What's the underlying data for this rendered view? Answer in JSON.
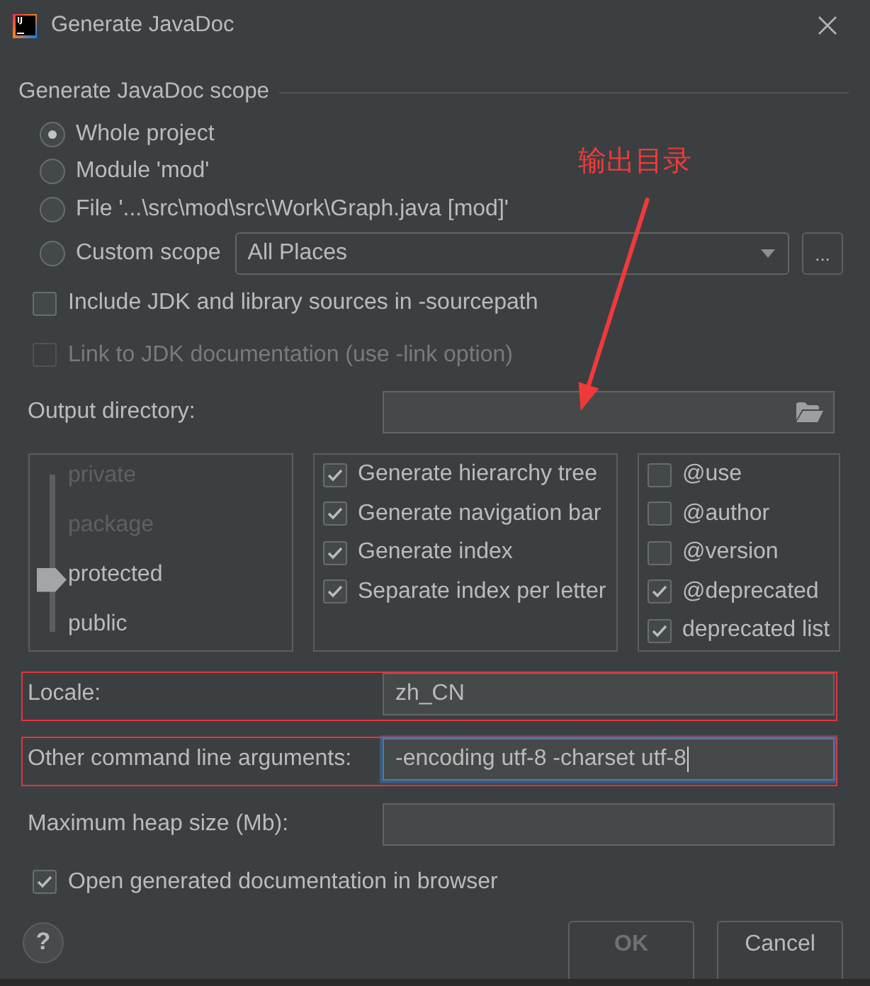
{
  "window": {
    "title": "Generate JavaDoc",
    "logo_text": "IJ"
  },
  "scope": {
    "title": "Generate JavaDoc scope",
    "options": [
      {
        "kind": "plain",
        "label": "Whole project",
        "selected": true
      },
      {
        "kind": "plain",
        "label": "Module 'mod'",
        "selected": false
      },
      {
        "kind": "plain",
        "label": "File '...\\src\\mod\\src\\Work\\Graph.java [mod]'",
        "selected": false
      },
      {
        "kind": "custom",
        "label": "Custom scope",
        "selected": false,
        "value": "All Places",
        "browse_button": "..."
      }
    ]
  },
  "sources": [
    {
      "label": "Include JDK and library sources in -sourcepath",
      "checked": false,
      "disabled": false
    },
    {
      "label": "Link to JDK documentation (use -link option)",
      "checked": false,
      "disabled": true
    }
  ],
  "output_directory": {
    "label": "Output directory:"
  },
  "visibility": {
    "levels": [
      {
        "label": "private",
        "selected": false
      },
      {
        "label": "package",
        "selected": false
      },
      {
        "label": "protected",
        "selected": true
      },
      {
        "label": "public",
        "selected": false
      }
    ]
  },
  "generate": [
    {
      "label": "Generate hierarchy tree",
      "checked": true
    },
    {
      "label": "Generate navigation bar",
      "checked": true
    },
    {
      "label": "Generate index",
      "checked": true
    },
    {
      "label": "Separate index per letter",
      "checked": true
    }
  ],
  "tags": [
    {
      "label": "@use",
      "checked": false
    },
    {
      "label": "@author",
      "checked": false
    },
    {
      "label": "@version",
      "checked": false
    },
    {
      "label": "@deprecated",
      "checked": true
    },
    {
      "label": "deprecated list",
      "checked": true
    }
  ],
  "fields": [
    {
      "label": "Locale:",
      "value": "zh_CN",
      "focused": false,
      "highlighted": true
    },
    {
      "label": "Other command line arguments:",
      "value": "-encoding utf-8 -charset utf-8",
      "focused": true,
      "highlighted": true
    },
    {
      "label": "Maximum heap size (Mb):",
      "focused": false
    }
  ],
  "open_in_browser": {
    "label": "Open generated documentation in browser",
    "checked": true
  },
  "help_button": "?",
  "buttons": [
    {
      "label": "OK",
      "default": true,
      "disabled": true
    },
    {
      "label": "Cancel",
      "default": false,
      "disabled": false
    }
  ],
  "annotation": {
    "label": "输出目录"
  }
}
